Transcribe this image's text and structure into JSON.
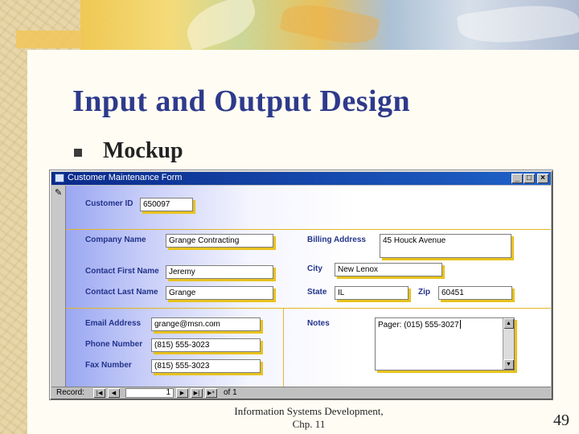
{
  "slide": {
    "title": "Input and Output Design",
    "bullet": "Mockup",
    "footer_line1": "Information Systems Development,",
    "footer_line2": "Chp. 11",
    "page_number": "49"
  },
  "window": {
    "title": "Customer Maintenance Form",
    "minimize_label": "_",
    "maximize_label": "□",
    "close_label": "×"
  },
  "form": {
    "customer_id": {
      "label": "Customer ID",
      "value": "650097"
    },
    "company_name": {
      "label": "Company Name",
      "value": "Grange Contracting"
    },
    "contact_first_name": {
      "label": "Contact First Name",
      "value": "Jeremy"
    },
    "contact_last_name": {
      "label": "Contact Last Name",
      "value": "Grange"
    },
    "billing_address": {
      "label": "Billing Address",
      "value": "45 Houck Avenue"
    },
    "city": {
      "label": "City",
      "value": "New Lenox"
    },
    "state": {
      "label": "State",
      "value": "IL"
    },
    "zip": {
      "label": "Zip",
      "value": "60451"
    },
    "email_address": {
      "label": "Email Address",
      "value": "grange@msn.com"
    },
    "phone_number": {
      "label": "Phone Number",
      "value": "(815) 555-3023"
    },
    "fax_number": {
      "label": "Fax Number",
      "value": "(815) 555-3023"
    },
    "notes": {
      "label": "Notes",
      "value": "Pager: (015) 555-3027"
    }
  },
  "navigation": {
    "record_label": "Record:",
    "current_record": "1",
    "of_label": "of 1"
  },
  "colors": {
    "title_color": "#2e3a8c",
    "titlebar_start": "#0a2a8a",
    "field_shadow": "#e8c21e",
    "label_color": "#23338a"
  }
}
